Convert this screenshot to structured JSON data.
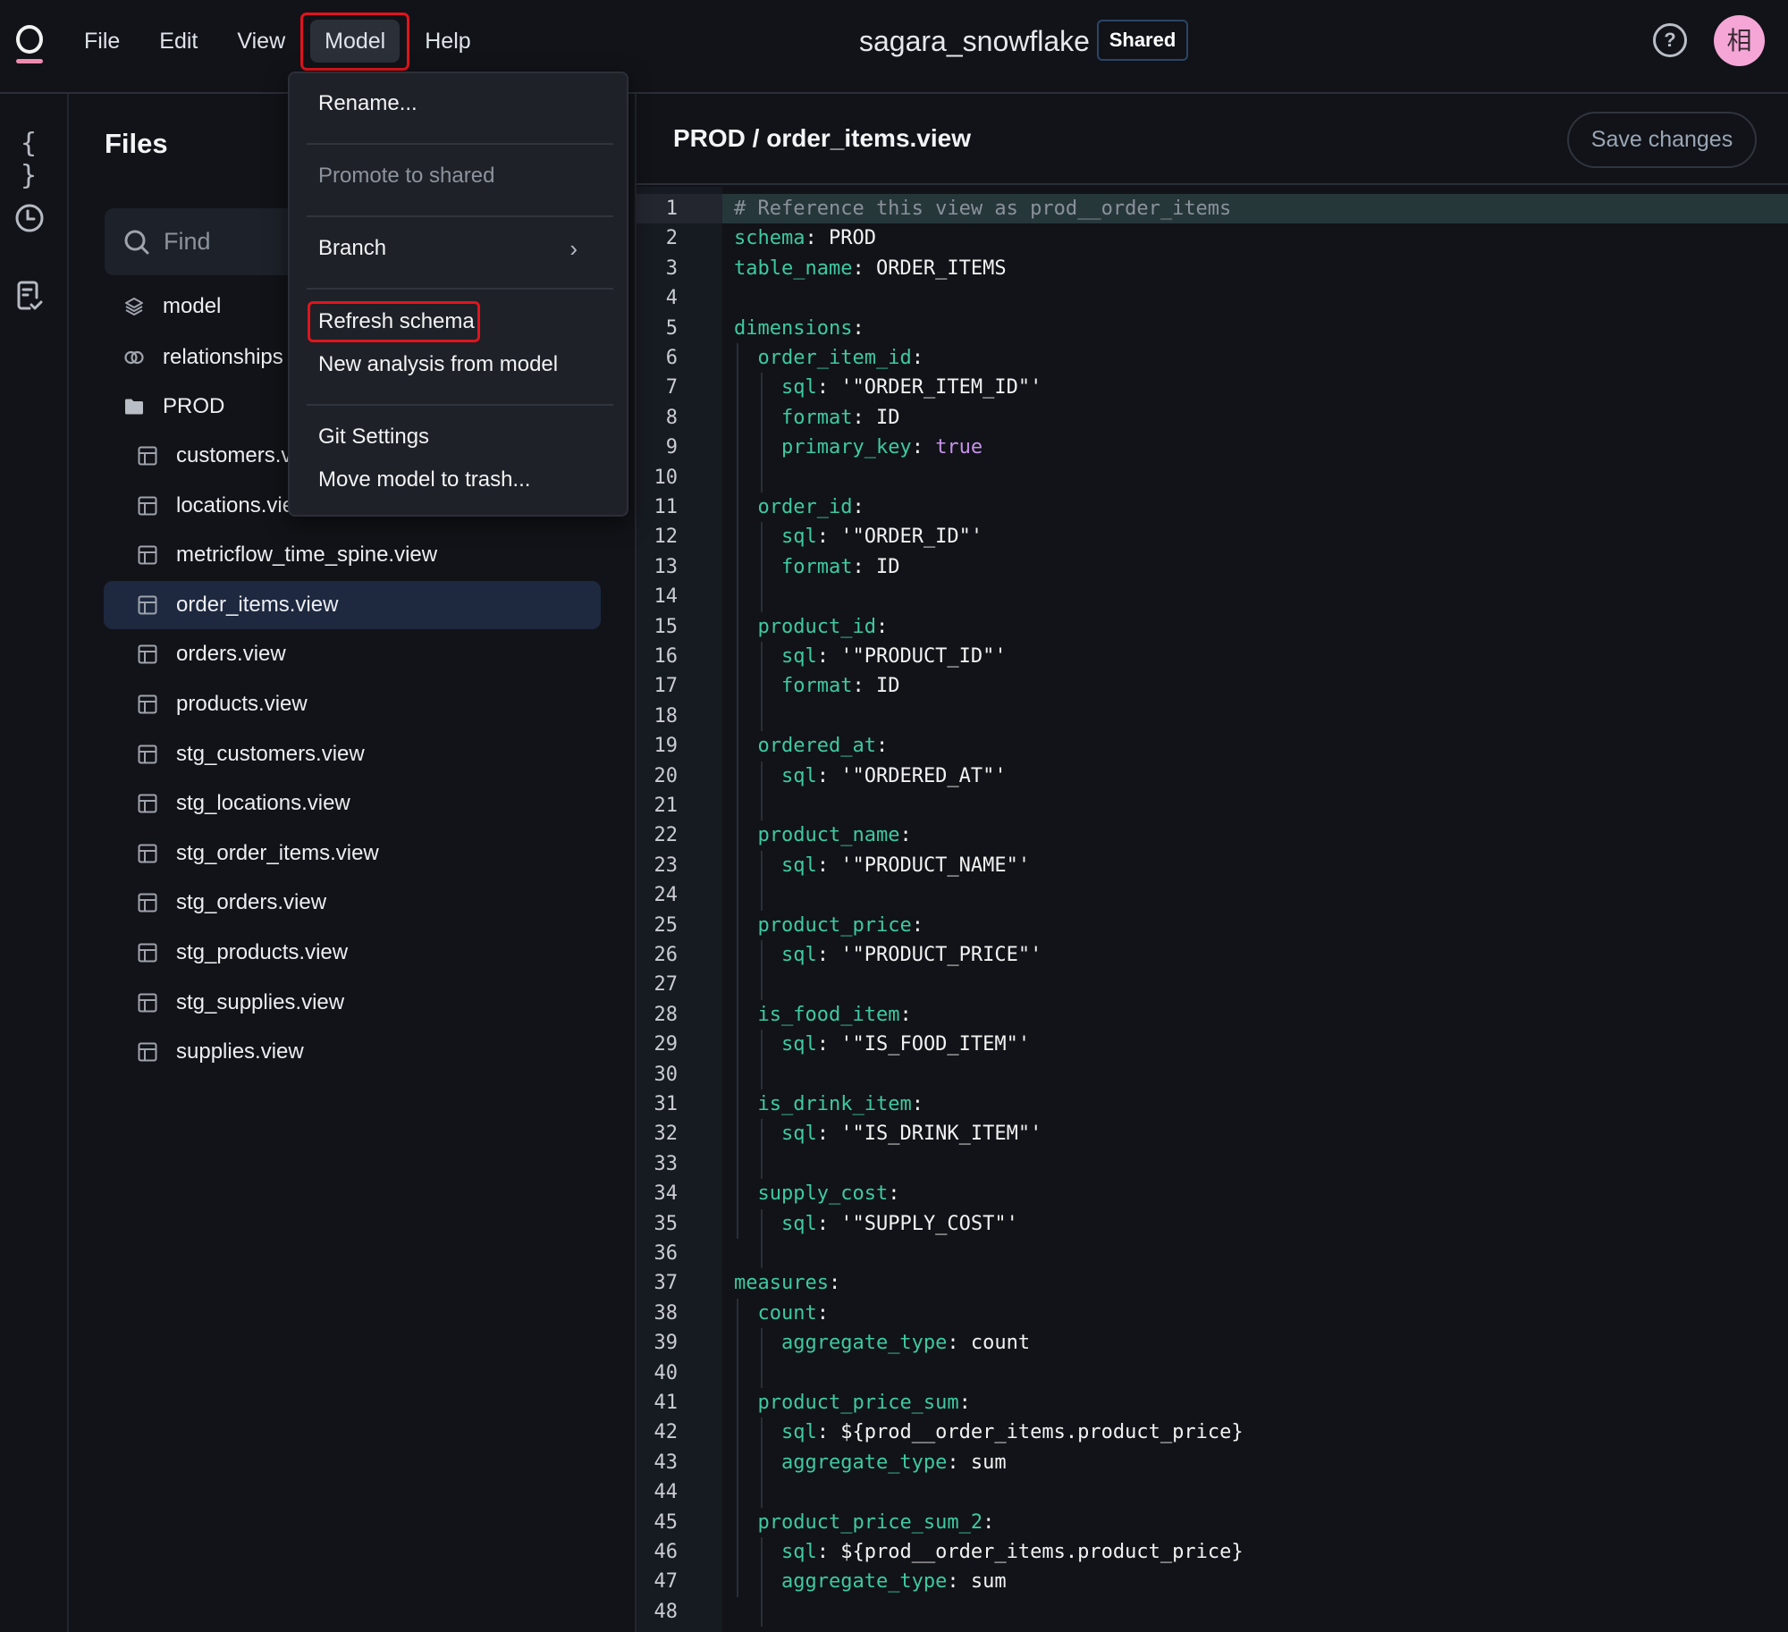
{
  "topbar": {
    "menu": [
      {
        "label": "File"
      },
      {
        "label": "Edit"
      },
      {
        "label": "View"
      },
      {
        "label": "Model",
        "active": true
      },
      {
        "label": "Help"
      }
    ],
    "title": "sagara_snowflake",
    "badge": "Shared",
    "help_icon": "?",
    "avatar_initial": "相",
    "avatar_color": "#f5a6d6"
  },
  "rail": {
    "icons": [
      "braces-icon",
      "clock-icon",
      "report-check-icon"
    ],
    "braces_glyph": "{ }"
  },
  "files": {
    "title": "Files",
    "search_placeholder": "Find",
    "top_items": [
      {
        "label": "model",
        "icon": "layers-icon"
      },
      {
        "label": "relationships",
        "icon": "link-icon"
      },
      {
        "label": "PROD",
        "icon": "folder-icon"
      }
    ],
    "items": [
      {
        "label": "customers.view"
      },
      {
        "label": "locations.view"
      },
      {
        "label": "metricflow_time_spine.view"
      },
      {
        "label": "order_items.view",
        "selected": true
      },
      {
        "label": "orders.view"
      },
      {
        "label": "products.view"
      },
      {
        "label": "stg_customers.view"
      },
      {
        "label": "stg_locations.view"
      },
      {
        "label": "stg_order_items.view"
      },
      {
        "label": "stg_orders.view"
      },
      {
        "label": "stg_products.view"
      },
      {
        "label": "stg_supplies.view"
      },
      {
        "label": "supplies.view"
      }
    ]
  },
  "editor": {
    "breadcrumb": "PROD / order_items.view",
    "save_label": "Save changes",
    "current_line": 1,
    "lines": [
      [
        [
          "comment",
          "# Reference this view as prod__order_items"
        ]
      ],
      [
        [
          "key",
          "schema"
        ],
        [
          "val",
          ": PROD"
        ]
      ],
      [
        [
          "key",
          "table_name"
        ],
        [
          "val",
          ": ORDER_ITEMS"
        ]
      ],
      [],
      [
        [
          "key",
          "dimensions"
        ],
        [
          "val",
          ":"
        ]
      ],
      [
        [
          "val",
          "  "
        ],
        [
          "key",
          "order_item_id"
        ],
        [
          "val",
          ":"
        ]
      ],
      [
        [
          "val",
          "    "
        ],
        [
          "key",
          "sql"
        ],
        [
          "val",
          ": '\"ORDER_ITEM_ID\"'"
        ]
      ],
      [
        [
          "val",
          "    "
        ],
        [
          "key",
          "format"
        ],
        [
          "val",
          ": ID"
        ]
      ],
      [
        [
          "val",
          "    "
        ],
        [
          "key",
          "primary_key"
        ],
        [
          "val",
          ": "
        ],
        [
          "bool",
          "true"
        ]
      ],
      [],
      [
        [
          "val",
          "  "
        ],
        [
          "key",
          "order_id"
        ],
        [
          "val",
          ":"
        ]
      ],
      [
        [
          "val",
          "    "
        ],
        [
          "key",
          "sql"
        ],
        [
          "val",
          ": '\"ORDER_ID\"'"
        ]
      ],
      [
        [
          "val",
          "    "
        ],
        [
          "key",
          "format"
        ],
        [
          "val",
          ": ID"
        ]
      ],
      [],
      [
        [
          "val",
          "  "
        ],
        [
          "key",
          "product_id"
        ],
        [
          "val",
          ":"
        ]
      ],
      [
        [
          "val",
          "    "
        ],
        [
          "key",
          "sql"
        ],
        [
          "val",
          ": '\"PRODUCT_ID\"'"
        ]
      ],
      [
        [
          "val",
          "    "
        ],
        [
          "key",
          "format"
        ],
        [
          "val",
          ": ID"
        ]
      ],
      [],
      [
        [
          "val",
          "  "
        ],
        [
          "key",
          "ordered_at"
        ],
        [
          "val",
          ":"
        ]
      ],
      [
        [
          "val",
          "    "
        ],
        [
          "key",
          "sql"
        ],
        [
          "val",
          ": '\"ORDERED_AT\"'"
        ]
      ],
      [],
      [
        [
          "val",
          "  "
        ],
        [
          "key",
          "product_name"
        ],
        [
          "val",
          ":"
        ]
      ],
      [
        [
          "val",
          "    "
        ],
        [
          "key",
          "sql"
        ],
        [
          "val",
          ": '\"PRODUCT_NAME\"'"
        ]
      ],
      [],
      [
        [
          "val",
          "  "
        ],
        [
          "key",
          "product_price"
        ],
        [
          "val",
          ":"
        ]
      ],
      [
        [
          "val",
          "    "
        ],
        [
          "key",
          "sql"
        ],
        [
          "val",
          ": '\"PRODUCT_PRICE\"'"
        ]
      ],
      [],
      [
        [
          "val",
          "  "
        ],
        [
          "key",
          "is_food_item"
        ],
        [
          "val",
          ":"
        ]
      ],
      [
        [
          "val",
          "    "
        ],
        [
          "key",
          "sql"
        ],
        [
          "val",
          ": '\"IS_FOOD_ITEM\"'"
        ]
      ],
      [],
      [
        [
          "val",
          "  "
        ],
        [
          "key",
          "is_drink_item"
        ],
        [
          "val",
          ":"
        ]
      ],
      [
        [
          "val",
          "    "
        ],
        [
          "key",
          "sql"
        ],
        [
          "val",
          ": '\"IS_DRINK_ITEM\"'"
        ]
      ],
      [],
      [
        [
          "val",
          "  "
        ],
        [
          "key",
          "supply_cost"
        ],
        [
          "val",
          ":"
        ]
      ],
      [
        [
          "val",
          "    "
        ],
        [
          "key",
          "sql"
        ],
        [
          "val",
          ": '\"SUPPLY_COST\"'"
        ]
      ],
      [],
      [
        [
          "key",
          "measures"
        ],
        [
          "val",
          ":"
        ]
      ],
      [
        [
          "val",
          "  "
        ],
        [
          "key",
          "count"
        ],
        [
          "val",
          ":"
        ]
      ],
      [
        [
          "val",
          "    "
        ],
        [
          "key",
          "aggregate_type"
        ],
        [
          "val",
          ": count"
        ]
      ],
      [],
      [
        [
          "val",
          "  "
        ],
        [
          "key",
          "product_price_sum"
        ],
        [
          "val",
          ":"
        ]
      ],
      [
        [
          "val",
          "    "
        ],
        [
          "key",
          "sql"
        ],
        [
          "val",
          ": ${prod__order_items.product_price}"
        ]
      ],
      [
        [
          "val",
          "    "
        ],
        [
          "key",
          "aggregate_type"
        ],
        [
          "val",
          ": sum"
        ]
      ],
      [],
      [
        [
          "val",
          "  "
        ],
        [
          "key",
          "product_price_sum_2"
        ],
        [
          "val",
          ":"
        ]
      ],
      [
        [
          "val",
          "    "
        ],
        [
          "key",
          "sql"
        ],
        [
          "val",
          ": ${prod__order_items.product_price}"
        ]
      ],
      [
        [
          "val",
          "    "
        ],
        [
          "key",
          "aggregate_type"
        ],
        [
          "val",
          ": sum"
        ]
      ],
      []
    ]
  },
  "model_menu": {
    "items": [
      {
        "label": "Rename...",
        "disabled": false
      },
      {
        "label": "Promote to shared",
        "disabled": true
      },
      {
        "label": "Branch",
        "submenu": true
      },
      {
        "label": "Refresh schema",
        "focused": true
      },
      {
        "label": "New analysis from model"
      },
      {
        "label": "Git Settings"
      },
      {
        "label": "Move model to trash..."
      }
    ],
    "chevron": "›"
  }
}
